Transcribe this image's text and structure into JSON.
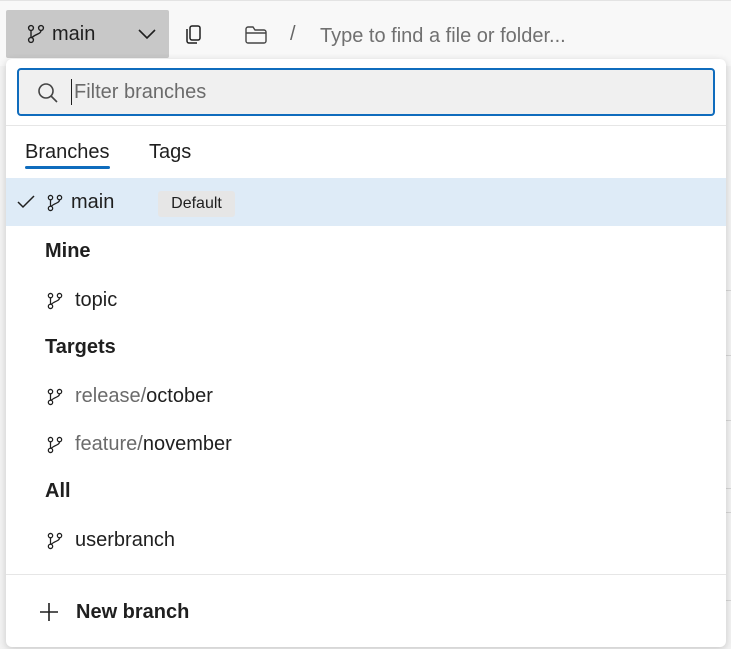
{
  "toolbar": {
    "branch_button": {
      "label": "main",
      "icon": "branch-icon",
      "chevron": "chevron-down-icon"
    },
    "copy_icon": "copy-icon",
    "folder_icon": "folder-icon",
    "path_separator": "/",
    "path_placeholder": "Type to find a file or folder..."
  },
  "popup": {
    "filter": {
      "placeholder": "Filter branches",
      "value": "",
      "icon": "search-icon"
    },
    "tabs": [
      {
        "label": "Branches",
        "active": true
      },
      {
        "label": "Tags",
        "active": false
      }
    ],
    "selected": {
      "name": "main",
      "badge": "Default",
      "check_icon": "check-icon"
    },
    "groups": [
      {
        "header": "Mine",
        "items": [
          {
            "prefix": "",
            "name": "topic"
          }
        ]
      },
      {
        "header": "Targets",
        "items": [
          {
            "prefix": "release/",
            "name": "october"
          },
          {
            "prefix": "feature/",
            "name": "november"
          }
        ]
      },
      {
        "header": "All",
        "items": [
          {
            "prefix": "",
            "name": "userbranch"
          }
        ]
      }
    ],
    "new_branch": {
      "label": "New branch",
      "icon": "plus-icon"
    }
  },
  "colors": {
    "accent": "#0f6cbd",
    "selected_row": "#deebf7",
    "button_bg": "#c8c8c8",
    "prefix_text": "#6b6b6b"
  }
}
